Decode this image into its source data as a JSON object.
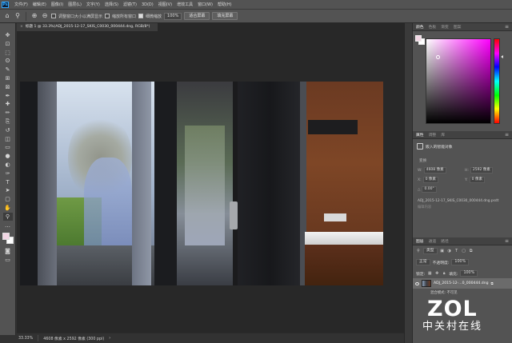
{
  "app": {
    "logo": "Ps"
  },
  "menubar": {
    "items": [
      "文件(F)",
      "编辑(E)",
      "图像(I)",
      "图层(L)",
      "文字(Y)",
      "选择(S)",
      "滤镜(T)",
      "3D(D)",
      "视图(V)",
      "增效工具",
      "窗口(W)",
      "帮助(H)"
    ]
  },
  "options": {
    "resize_windows_label": "调整窗口大小以满屏显示",
    "zoom_all_label": "缩放所有窗口",
    "scrubby_zoom_label": "细微缩放",
    "zoom_value": "100%",
    "fit_screen_label": "适合屏幕",
    "fill_screen_label": "填充屏幕"
  },
  "tools": {
    "icons": [
      "move-icon",
      "artboard-icon",
      "marquee-icon",
      "lasso-icon",
      "quick-select-icon",
      "crop-icon",
      "frame-icon",
      "eyedropper-icon",
      "healing-brush-icon",
      "brush-icon",
      "clone-stamp-icon",
      "history-brush-icon",
      "eraser-icon",
      "gradient-icon",
      "blur-icon",
      "dodge-icon",
      "pen-icon",
      "type-icon",
      "path-select-icon",
      "rectangle-icon",
      "hand-icon",
      "zoom-icon"
    ],
    "glyphs": [
      "✥",
      "⊡",
      "⬚",
      "ʘ",
      "✎",
      "⊞",
      "⊠",
      "✒",
      "✚",
      "✏",
      "⎘",
      "↺",
      "◫",
      "▭",
      "●",
      "◐",
      "✑",
      "T",
      "➤",
      "▢",
      "✋",
      "⚲"
    ],
    "active_index": 21,
    "foreground_color": "#f2d6e4",
    "background_color": "#ffffff"
  },
  "document": {
    "tab_title": "标题 1 @ 33.3%(ADJ_2015-12-17_SKIS_C0030_000444.dng, RGB/8*)",
    "zoom": "33.33%",
    "dimensions": "4608 像素 x 2592 像素 (300 ppi)"
  },
  "color_panel": {
    "tabs": [
      "颜色",
      "色板",
      "渐变",
      "图案"
    ],
    "foreground": "#f2d6e4",
    "hue": "#ff00ff"
  },
  "properties_panel": {
    "tabs": [
      "属性",
      "调整",
      "库"
    ],
    "doc_label": "嵌入的智能对象",
    "section_label": "变换",
    "width_label": "W:",
    "width_value": "4608 像素",
    "height_label": "H:",
    "height_value": "2592 像素",
    "x_label": "X:",
    "x_value": "0 像素",
    "y_label": "Y:",
    "y_value": "0 像素",
    "angle_label": "△",
    "angle_value": "0.00°",
    "file_name": "ADJ_2015-12-17_SKIS_C0030_000444.dng.psdt",
    "hint": "编辑内容"
  },
  "layers_panel": {
    "tabs": [
      "图层",
      "通道",
      "路径"
    ],
    "filter_label": "类型",
    "blend_mode": "正常",
    "opacity_label": "不透明度:",
    "opacity_value": "100%",
    "lock_label": "锁定:",
    "fill_label": "填充:",
    "fill_value": "100%",
    "layer_name": "ADJ_2015-12-...0_000444.dng",
    "layer_sub": "混合模式: 不可见"
  },
  "watermark": {
    "logo": "ZOL",
    "subtitle": "中关村在线"
  }
}
